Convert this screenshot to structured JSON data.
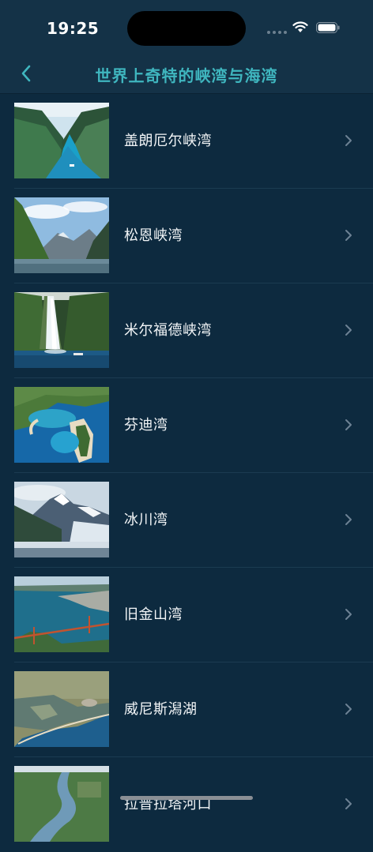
{
  "status": {
    "time": "19:25"
  },
  "nav": {
    "title": "世界上奇特的峡湾与海湾"
  },
  "items": [
    {
      "label": "盖朗厄尔峡湾"
    },
    {
      "label": "松恩峡湾"
    },
    {
      "label": "米尔福德峡湾"
    },
    {
      "label": "芬迪湾"
    },
    {
      "label": "冰川湾"
    },
    {
      "label": "旧金山湾"
    },
    {
      "label": "威尼斯潟湖"
    },
    {
      "label": "拉普拉塔河口"
    }
  ],
  "colors": {
    "background": "#0d2a3f",
    "header": "#143247",
    "accent": "#3fb6bf"
  }
}
